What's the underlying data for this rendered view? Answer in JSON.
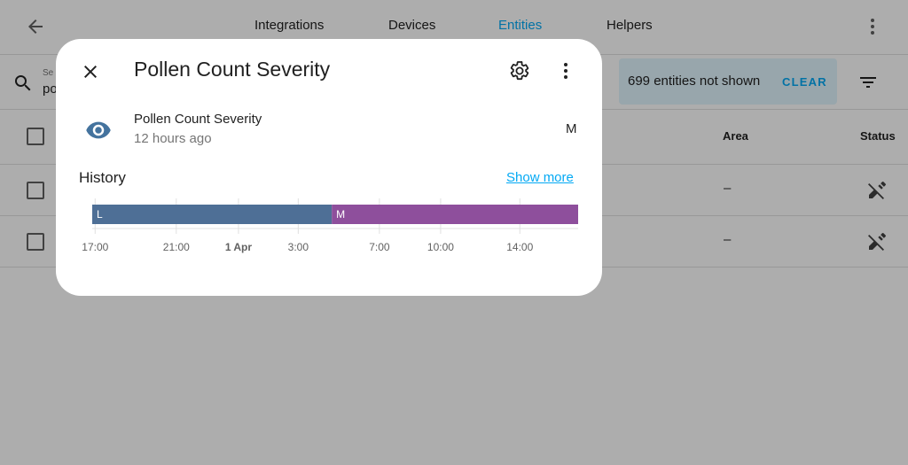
{
  "header": {
    "tabs": [
      {
        "label": "Integrations",
        "active": false
      },
      {
        "label": "Devices",
        "active": false
      },
      {
        "label": "Entities",
        "active": true
      },
      {
        "label": "Helpers",
        "active": false
      }
    ]
  },
  "search": {
    "label": "Se",
    "value": "po"
  },
  "filter_banner": {
    "text": "699 entities not shown",
    "clear_label": "CLEAR"
  },
  "table": {
    "columns": {
      "area": "Area",
      "status": "Status"
    },
    "rows": [
      {
        "area": "–",
        "status_icon": "pencil-off-icon"
      },
      {
        "area": "–",
        "status_icon": "pencil-off-icon"
      }
    ]
  },
  "dialog": {
    "title": "Pollen Count Severity",
    "entity_name": "Pollen Count Severity",
    "last_changed": "12 hours ago",
    "state": "M",
    "history_label": "History",
    "show_more": "Show more"
  },
  "chart_data": {
    "type": "timeline",
    "segments": [
      {
        "label": "L",
        "color": "#4e6f96",
        "start_frac": 0.0,
        "end_frac": 0.493
      },
      {
        "label": "M",
        "color": "#8e4f9c",
        "start_frac": 0.493,
        "end_frac": 1.0
      }
    ],
    "ticks": [
      {
        "label": "17:00",
        "frac": 0.006,
        "bold": false
      },
      {
        "label": "21:00",
        "frac": 0.173,
        "bold": false
      },
      {
        "label": "1 Apr",
        "frac": 0.301,
        "bold": true
      },
      {
        "label": "3:00",
        "frac": 0.424,
        "bold": false
      },
      {
        "label": "7:00",
        "frac": 0.591,
        "bold": false
      },
      {
        "label": "10:00",
        "frac": 0.717,
        "bold": false
      },
      {
        "label": "14:00",
        "frac": 0.88,
        "bold": false
      }
    ]
  },
  "colors": {
    "accent": "#03a9f4",
    "state_icon": "#44739e",
    "scrim": "rgba(0,0,0,0.32)"
  }
}
